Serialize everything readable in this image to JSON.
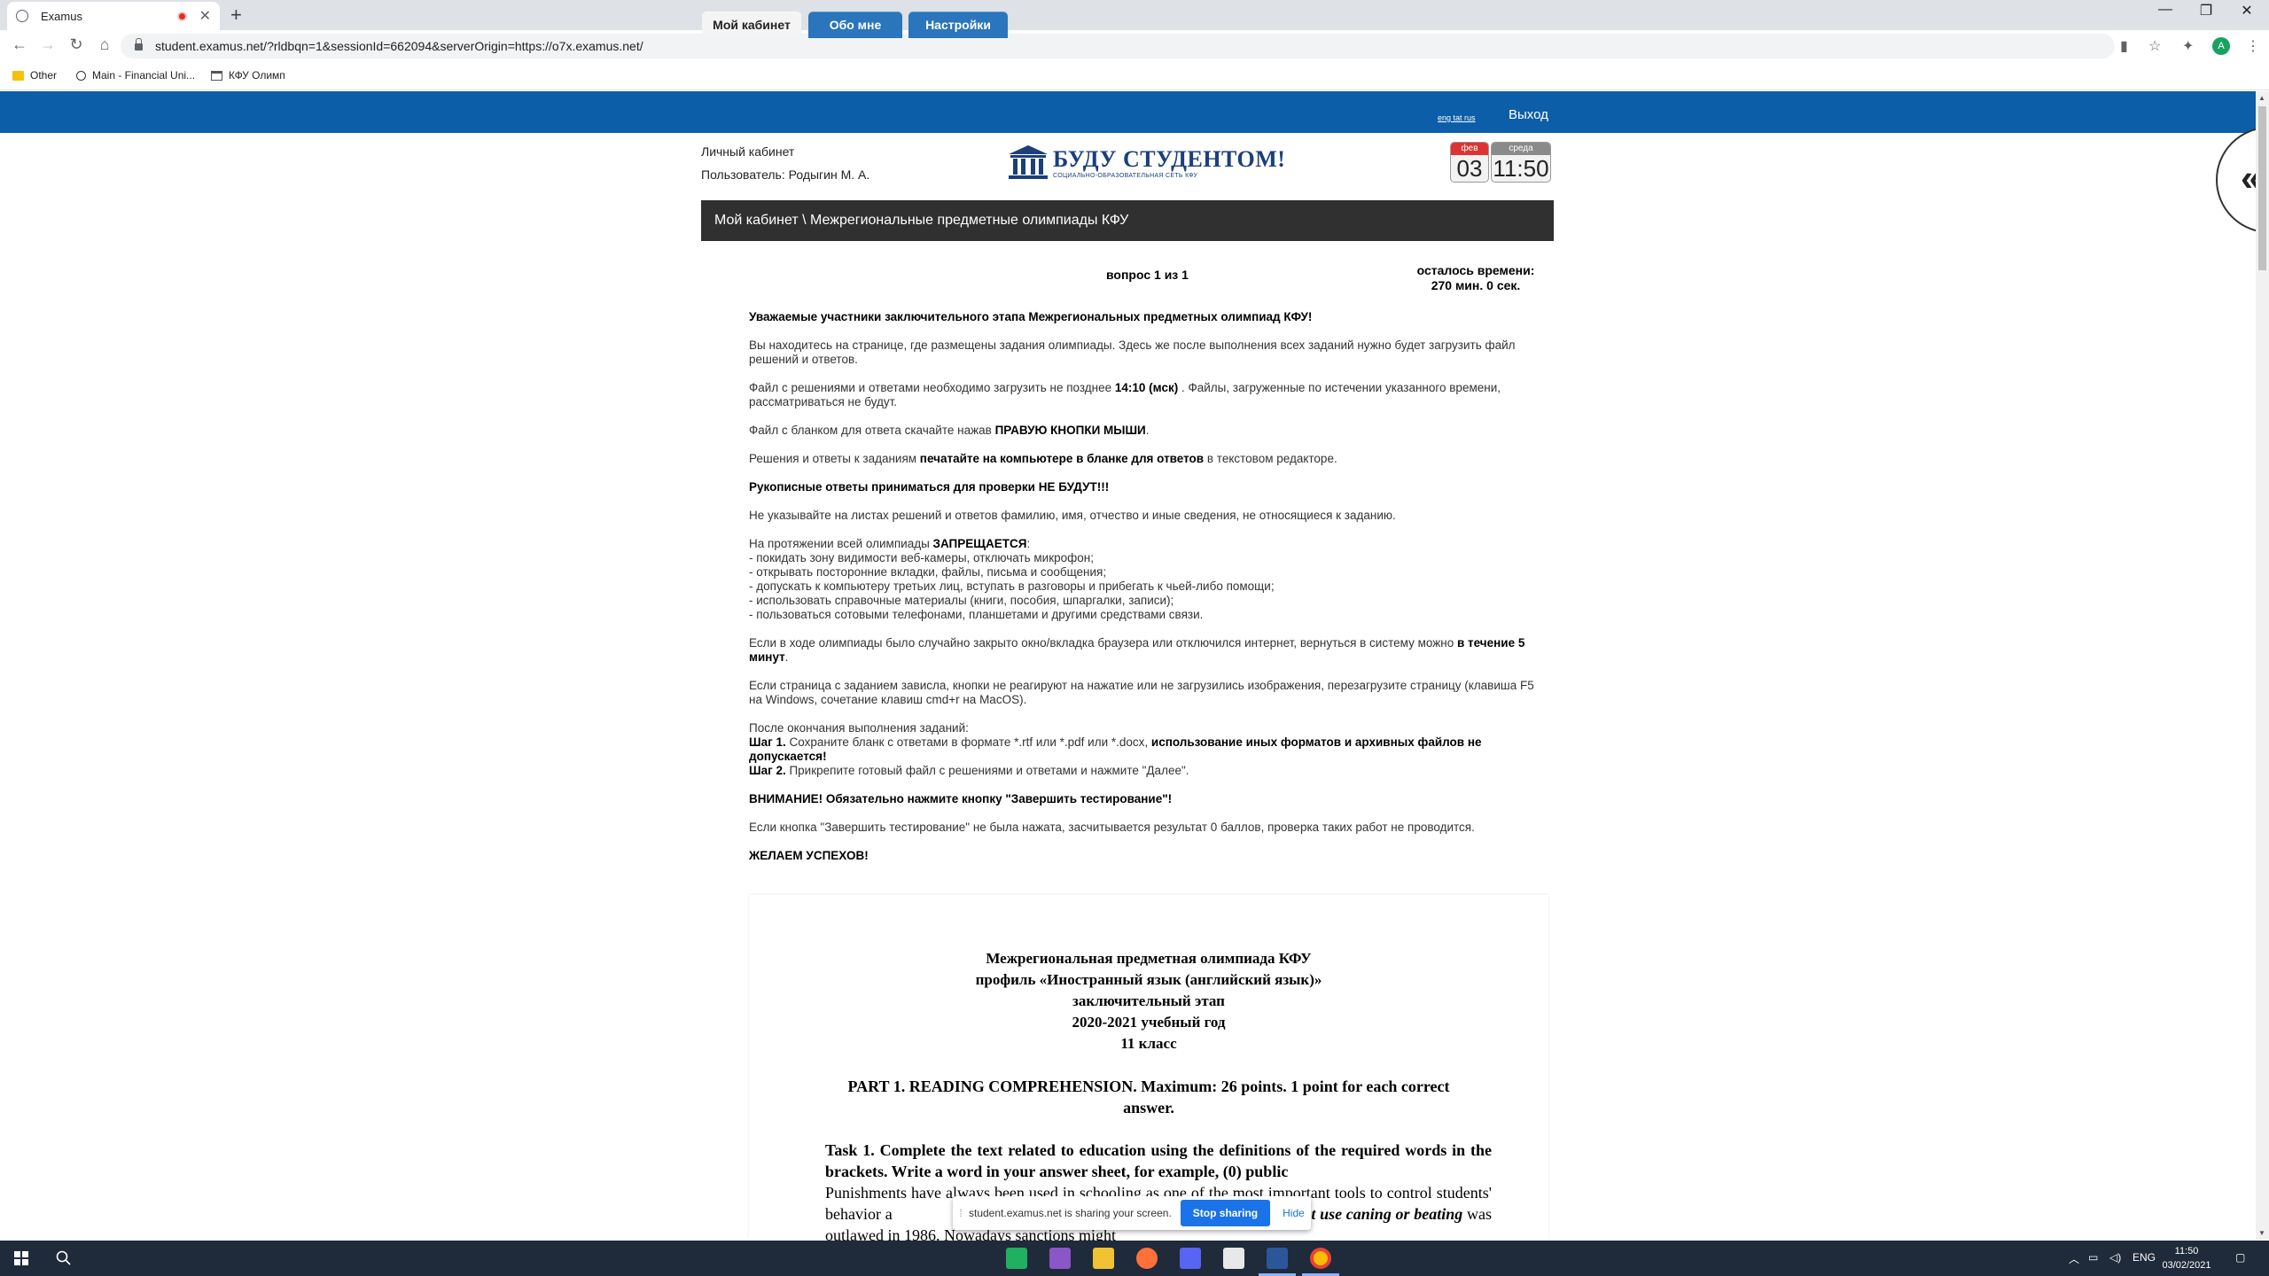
{
  "browser": {
    "tab_title": "Examus",
    "url": "student.examus.net/?rldbqn=1&sessionId=662094&serverOrigin=https://o7x.examus.net/",
    "bookmarks": [
      "Other",
      "Main - Financial Uni...",
      "КФУ Олимп"
    ]
  },
  "nav": {
    "tabs": [
      "Мой кабинет",
      "Обо мне",
      "Настройки"
    ],
    "langs": "eng tat rus",
    "logout": "Выход"
  },
  "header": {
    "cabinet": "Личный кабинет",
    "user": "Пользователь: Родыгин М. А.",
    "logo_title": "БУДУ СТУДЕНТОМ!",
    "logo_subtitle": "СОЦИАЛЬНО-ОБРАЗОВАТЕЛЬНАЯ СЕТЬ КФУ",
    "cal_month": "фев",
    "cal_day": "03",
    "cal_weekday": "среда",
    "cal_time": "11:50"
  },
  "breadcrumb": "Мой кабинет \\ Межрегиональные предметные олимпиады КФУ",
  "question": {
    "counter": "вопрос 1 из 1",
    "remaining_label": "осталось времени:",
    "remaining_value": "270 мин. 0 сек."
  },
  "intro": {
    "greeting": "Уважаемые участники заключительного этапа Межрегиональных предметных олимпиад КФУ!",
    "p1": "Вы находитесь на странице, где размещены задания олимпиады. Здесь же после выполнения всех заданий нужно будет загрузить файл решений и ответов.",
    "p2a": "Файл с решениями и ответами необходимо загрузить не позднее ",
    "p2b": "14:10 (мск)",
    "p2c": " . Файлы, загруженные по истечении указанного времени, рассматриваться не будут.",
    "p3a": "Файл с бланком для ответа скачайте нажав ",
    "p3b": "ПРАВУЮ КНОПКИ МЫШИ",
    "p3c": ".",
    "p4a": "Решения и ответы к заданиям ",
    "p4b": "печатайте на компьютере в бланке для ответов",
    "p4c": " в текстовом редакторе.",
    "p5": "Рукописные ответы приниматься для проверки НЕ БУДУТ!!!",
    "p6": "Не указывайте на листах решений и ответов фамилию, имя, отчество и иные сведения, не относящиеся к заданию.",
    "p7a": "На протяжении всей олимпиады ",
    "p7b": "ЗАПРЕЩАЕТСЯ",
    "p7c": ":",
    "bans": [
      "- покидать зону видимости веб-камеры, отключать микрофон;",
      "- открывать посторонние вкладки, файлы, письма и сообщения;",
      "- допускать к компьютеру третьих лиц, вступать в разговоры и прибегать к чьей-либо помощи;",
      "- использовать справочные материалы (книги, пособия, шпаргалки, записи);",
      "- пользоваться сотовыми телефонами, планшетами и другими средствами связи."
    ],
    "p8a": "Если в ходе олимпиады было случайно закрыто окно/вкладка браузера или отключился интернет, вернуться в систему можно ",
    "p8b": "в течение 5 минут",
    "p8c": ".",
    "p9": "Если страница с заданием зависла, кнопки не реагируют на нажатие или не загрузились изображения, перезагрузите страницу (клавиша F5 на Windows, сочетание клавиш cmd+r на MacOS).",
    "p10": "После окончания выполнения заданий:",
    "step1_label": "Шаг 1.",
    "step1_text": " Сохраните бланк с ответами в формате *.rtf или *.pdf или *.docx, ",
    "step1_bold": "использование иных форматов и архивных файлов не допускается!",
    "step2_label": "Шаг 2.",
    "step2_text": " Прикрепите готовый файл с решениями и ответами и нажмите \"Далее\".",
    "attention": "ВНИМАНИЕ! Обязательно нажмите кнопку \"Завершить тестирование\"!",
    "p11": "Если кнопка \"Завершить тестирование\" не была нажата, засчитывается результат 0 баллов, проверка таких работ не проводится.",
    "good_luck": "ЖЕЛАЕМ УСПЕХОВ!"
  },
  "doc": {
    "heading": [
      "Межрегиональная предметная олимпиада КФУ",
      "профиль «Иностранный язык (английский язык)»",
      "заключительный этап",
      "2020-2021 учебный год",
      "11 класс"
    ],
    "part": "PART 1. READING COMPREHENSION. Maximum: 26 points. 1 point for each correct answer.",
    "task": "Task 1. Complete the text related to education using the definitions of the required words in the brackets. Write a word in your answer sheet, for example, (0) public",
    "body_a": "Punishments have always been used in schooling as one of the most important tools to control students' behavior a",
    "body_b": "hment which includes any physical punishment use caning or beating",
    "body_c": " was outlawed in 1986. Nowadays sanctions might"
  },
  "sharebar": {
    "text": "student.examus.net is sharing your screen.",
    "stop": "Stop sharing",
    "hide": "Hide"
  },
  "taskbar": {
    "lang": "ENG",
    "time": "11:50",
    "date": "03/02/2021"
  }
}
